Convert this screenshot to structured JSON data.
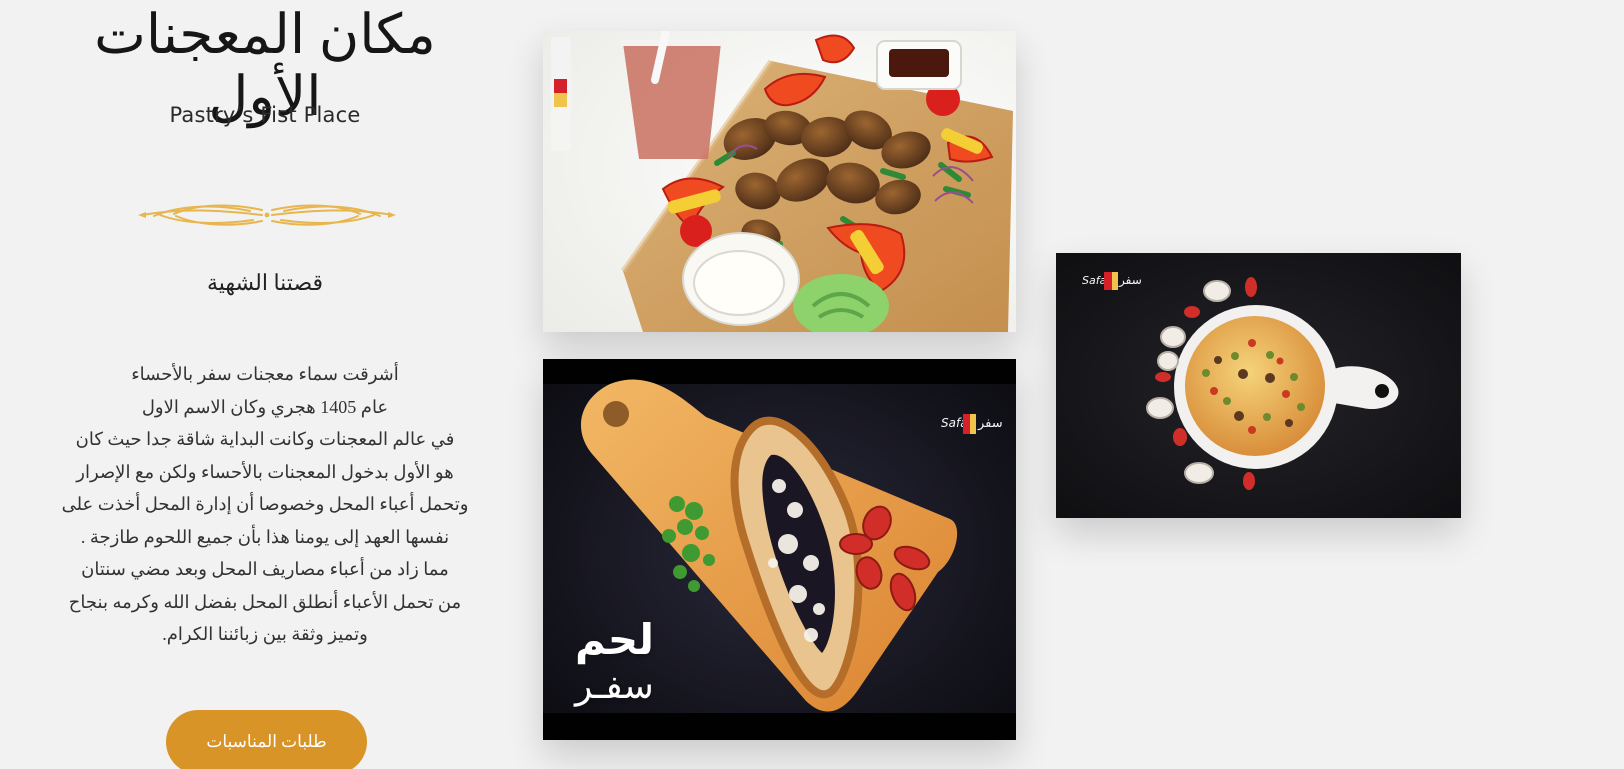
{
  "hero": {
    "title": "مكان المعجنات الأول",
    "subtitle": "Pastry’s Fist Place"
  },
  "story": {
    "heading": "قصتنا الشهية",
    "lines": [
      "أشرقت سماء معجنات سفر بالأحساء",
      "عام 1405 هجري وكان الاسم الاول",
      "في عالم المعجنات وكانت البداية شاقة جدا حيث كان",
      "هو الأول بدخول المعجنات بالأحساء ولكن مع الإصرار",
      "وتحمل أعباء المحل وخصوصا أن إدارة المحل أخذت على",
      "نفسها العهد إلى يومنا هذا بأن جميع اللحوم طازجة .",
      "مما زاد من أعباء مصاريف المحل وبعد مضي سنتان",
      "من تحمل الأعباء أنطلق المحل بفضل الله وكرمه بنجاح",
      "وتميز وثقة بين زبائننا الكرام."
    ]
  },
  "cta": {
    "label": "طلبات المناسبات"
  },
  "gallery": {
    "photos": [
      {
        "subject": "grilled-kebab-platter"
      },
      {
        "subject": "lahm-pide-board",
        "overlay_line1": "لحم",
        "overlay_line2": "سفـر"
      },
      {
        "subject": "pizza-board"
      }
    ],
    "watermark_en": "Safar",
    "watermark_ar": "سفر"
  },
  "colors": {
    "background": "#f2f2f2",
    "accent": "#d99427",
    "text": "#1b1b1b",
    "divider": "#e7b64f"
  },
  "icons": {
    "divider": "wheat-ornament-icon",
    "watermark": "safar-logo-icon"
  }
}
